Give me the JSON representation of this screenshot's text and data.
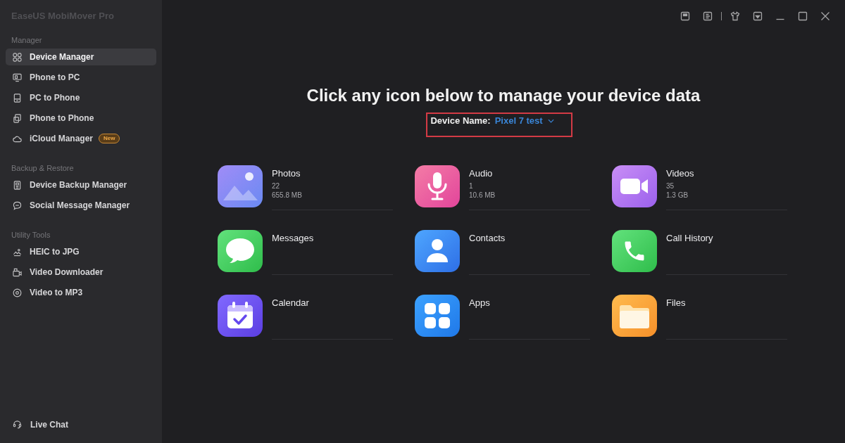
{
  "app": {
    "title": "EaseUS MobiMover Pro"
  },
  "sidebar": {
    "sections": [
      {
        "heading": "Manager",
        "items": [
          {
            "label": "Device Manager",
            "selected": true
          },
          {
            "label": "Phone to PC",
            "selected": false
          },
          {
            "label": "PC to Phone",
            "selected": false
          },
          {
            "label": "Phone to Phone",
            "selected": false
          },
          {
            "label": "iCloud Manager",
            "selected": false,
            "badge": "New"
          }
        ]
      },
      {
        "heading": "Backup & Restore",
        "items": [
          {
            "label": "Device Backup Manager",
            "selected": false
          },
          {
            "label": "Social Message Manager",
            "selected": false
          }
        ]
      },
      {
        "heading": "Utility Tools",
        "items": [
          {
            "label": "HEIC to JPG",
            "selected": false
          },
          {
            "label": "Video Downloader",
            "selected": false
          },
          {
            "label": "Video to MP3",
            "selected": false
          }
        ]
      }
    ],
    "footer": {
      "label": "Live Chat"
    }
  },
  "heading": "Click any icon below to manage your device data",
  "device": {
    "label": "Device Name:",
    "value": "Pixel 7 test",
    "highlighted": true
  },
  "categories": [
    {
      "name": "Photos",
      "count": "22",
      "size": "655.8 MB"
    },
    {
      "name": "Audio",
      "count": "1",
      "size": "10.6 MB"
    },
    {
      "name": "Videos",
      "count": "35",
      "size": "1.3 GB"
    },
    {
      "name": "Messages"
    },
    {
      "name": "Contacts"
    },
    {
      "name": "Call History"
    },
    {
      "name": "Calendar"
    },
    {
      "name": "Apps"
    },
    {
      "name": "Files"
    }
  ]
}
